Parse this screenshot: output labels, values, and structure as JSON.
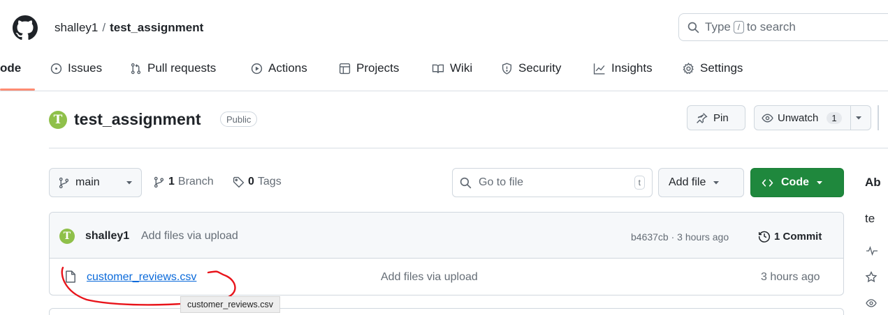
{
  "header": {
    "owner": "shalley1",
    "separator": "/",
    "repo": "test_assignment",
    "search_prefix": "Type",
    "search_key": "/",
    "search_suffix": "to search"
  },
  "nav": {
    "active_partial": "ode",
    "items": [
      "Issues",
      "Pull requests",
      "Actions",
      "Projects",
      "Wiki",
      "Security",
      "Insights",
      "Settings"
    ]
  },
  "repo": {
    "avatar_letter": "T",
    "name": "test_assignment",
    "visibility": "Public",
    "pin_label": "Pin",
    "unwatch_label": "Unwatch",
    "watch_count": "1"
  },
  "branch_bar": {
    "branch": "main",
    "branch_count": "1",
    "branch_word": "Branch",
    "tag_count": "0",
    "tag_word": "Tags",
    "goto_placeholder": "Go to file",
    "goto_key": "t",
    "add_file": "Add file",
    "code": "Code"
  },
  "about": {
    "heading_partial": "Ab",
    "desc_partial": "te"
  },
  "commit": {
    "author": "shalley1",
    "message": "Add files via upload",
    "sha_time": "b4637cb · 3 hours ago",
    "commit_count": "1 Commit"
  },
  "files": [
    {
      "name": "customer_reviews.csv",
      "message": "Add files via upload",
      "time": "3 hours ago"
    }
  ],
  "tooltip": "customer_reviews.csv",
  "colors": {
    "accent_green": "#1f883d",
    "link_blue": "#0969da",
    "annotation_red": "#e8141b",
    "nav_underline": "#fd8c73"
  }
}
